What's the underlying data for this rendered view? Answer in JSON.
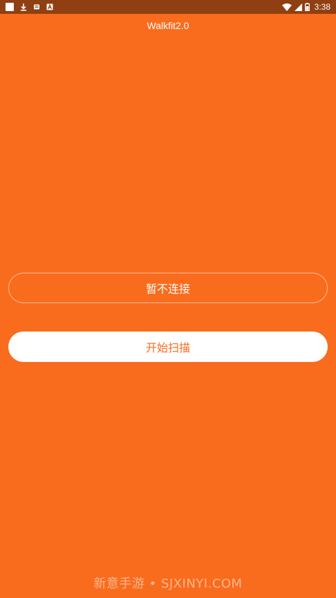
{
  "status_bar": {
    "time": "3:38",
    "icons_left": [
      "square-notification-icon",
      "download-icon",
      "sd-card-icon",
      "text-a-icon"
    ],
    "icons_right": [
      "wifi-icon",
      "signal-icon",
      "battery-icon"
    ]
  },
  "app": {
    "title": "Walkfit2.0"
  },
  "buttons": {
    "skip_connect_label": "暂不连接",
    "start_scan_label": "开始扫描"
  },
  "watermark": {
    "text": "新意手游 • SJXINYI.COM"
  },
  "colors": {
    "background": "#f96c1d",
    "status_bar": "#8f3f11",
    "button_text_accent": "#f96c1d",
    "white": "#ffffff"
  }
}
